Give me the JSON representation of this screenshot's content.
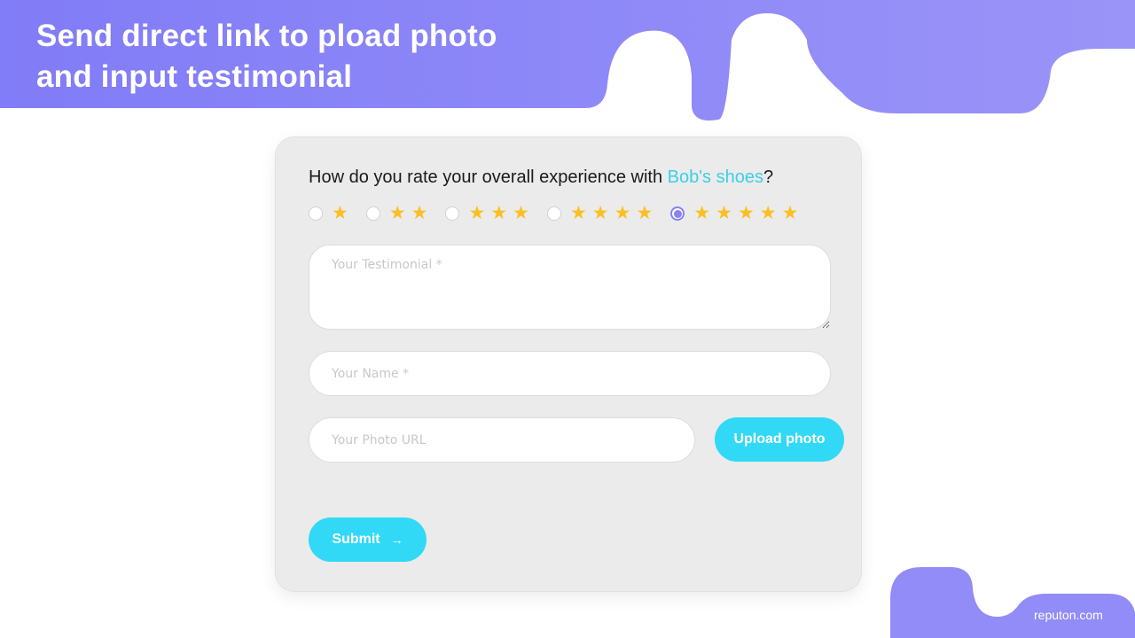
{
  "banner": {
    "headline_line1": "Send direct link to pload photo",
    "headline_line2": "and input testimonial",
    "color": "#8a86f7"
  },
  "form": {
    "question_prefix": "How do you rate your overall experience with ",
    "brand_name": "Bob's shoes",
    "question_suffix": "?",
    "rating": {
      "options": [
        {
          "stars": 1,
          "selected": false
        },
        {
          "stars": 2,
          "selected": false
        },
        {
          "stars": 3,
          "selected": false
        },
        {
          "stars": 4,
          "selected": false
        },
        {
          "stars": 5,
          "selected": true
        }
      ],
      "selected_value": 5,
      "star_glyph": "★"
    },
    "testimonial": {
      "value": "",
      "placeholder": "Your Testimonial *"
    },
    "name": {
      "value": "",
      "placeholder": "Your Name *"
    },
    "photo_url": {
      "value": "",
      "placeholder": "Your Photo URL"
    },
    "upload_label": "Upload photo",
    "submit_label": "Submit",
    "submit_icon": "→"
  },
  "footer": {
    "brand": "reputon.com"
  },
  "colors": {
    "accent": "#31d9f6",
    "purple": "#8a86f7",
    "star": "#fbbf24",
    "link": "#3bcfe8"
  }
}
